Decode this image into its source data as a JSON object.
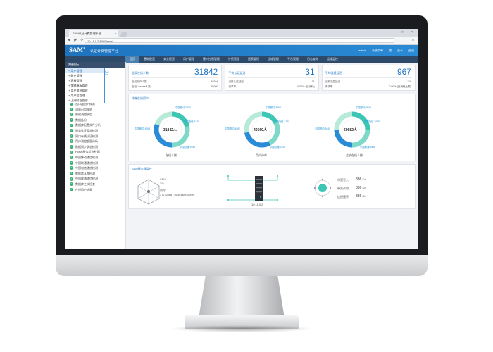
{
  "browser": {
    "tab_title": "SAM认证计费管理平台",
    "tab_close": "×",
    "url": "10.11.0.2:8080/sam/",
    "window_controls": "–  □  ×",
    "nav_glyphs": "◀ ▶ ⟳",
    "menu_glyph": "≡"
  },
  "app": {
    "logo": "SAM",
    "logo_sup": "®",
    "platform_name": "认证计费管理平台",
    "user": "admin",
    "system_menu": "系统菜单",
    "lock": "锁",
    "about": "关于",
    "logout": "退出"
  },
  "nav": [
    "首页",
    "基础配置",
    "安全配置",
    "用户管理",
    "接入控制管理",
    "计费管理",
    "报表管理",
    "运维管理",
    "平台管理",
    "日志查询",
    "运维监控"
  ],
  "sidebar": {
    "header": "快捷面板",
    "dropdown": [
      "用户管理",
      "账户管理",
      "套餐管理",
      "策略模板管理",
      "用户消息管理",
      "用户组管理",
      "上网时段管理"
    ],
    "partial_text": "分",
    "category": "日志管理",
    "items": [
      "出口路由IP探测",
      "流量可用规则",
      "前缀流控模型",
      "数据备份",
      "数据库配置文件分析",
      "服务认证异常检测",
      "网口有线认证检测",
      "用户流控超量分析",
      "数据同步状态检测",
      "Portal服务状态检测",
      "中国移动通信检测",
      "中国联通通信检测",
      "中国电信通信检测",
      "数据库从库检测",
      "中国联通通信检测",
      "数据库主从检查",
      "在线用户流量"
    ]
  },
  "cards": [
    {
      "title": "全局在线人数",
      "value": "31842",
      "r1_label": "全校用户人数",
      "r1_value": "40394",
      "r2_label": "全校License人数",
      "r2_value": "55000"
    },
    {
      "title": "平均认证延迟",
      "value": "31",
      "r1_label": "当前认证延迟",
      "r1_value": "11",
      "r2_label": "请求率",
      "r2_value": "0.00% (已消耗)"
    },
    {
      "title": "平均流量延迟",
      "value": "967",
      "r1_label": "当前流量延迟",
      "r1_value": "119",
      "r2_label": "请求率",
      "r2_value": "0.00% (已消耗上限)"
    }
  ],
  "online_panel": {
    "title": "终端在线用户",
    "donuts": [
      {
        "center": "31842人",
        "caption": "在线人数",
        "labels": [
          "中国移动 9195",
          "中国移动 4763",
          "中国联通 9456",
          "中国电信 8428"
        ]
      },
      {
        "center": "46660人",
        "caption": "用户分布",
        "labels": [
          "中国移动 8567",
          "中国移动 4567",
          "中国联通 2345",
          "中国电信 4780"
        ]
      },
      {
        "center": "69682人",
        "caption": "全校在线人数",
        "labels": [
          "中国移动 9905",
          "中国移动 8549",
          "中国联通 8456",
          "中国电信 7628"
        ]
      }
    ]
  },
  "monitor_panel": {
    "title": "SAM服务器监控",
    "cpu_label": "CPU",
    "cpu_value": "3%",
    "mem_label": "内存",
    "mem_value": "37772MB / 65301MB (58%)",
    "server_ip": "10.11.0.2",
    "net": [
      {
        "label": "带宽写入",
        "value": "386",
        "unit": "K/s"
      },
      {
        "label": "带宽读取",
        "value": "386",
        "unit": "K/s"
      },
      {
        "label": "连接速率",
        "value": "386",
        "unit": "K/s"
      }
    ]
  },
  "colors": {
    "primary": "#1e73be",
    "accent": "#3ec6b4",
    "green": "#38b06f"
  }
}
